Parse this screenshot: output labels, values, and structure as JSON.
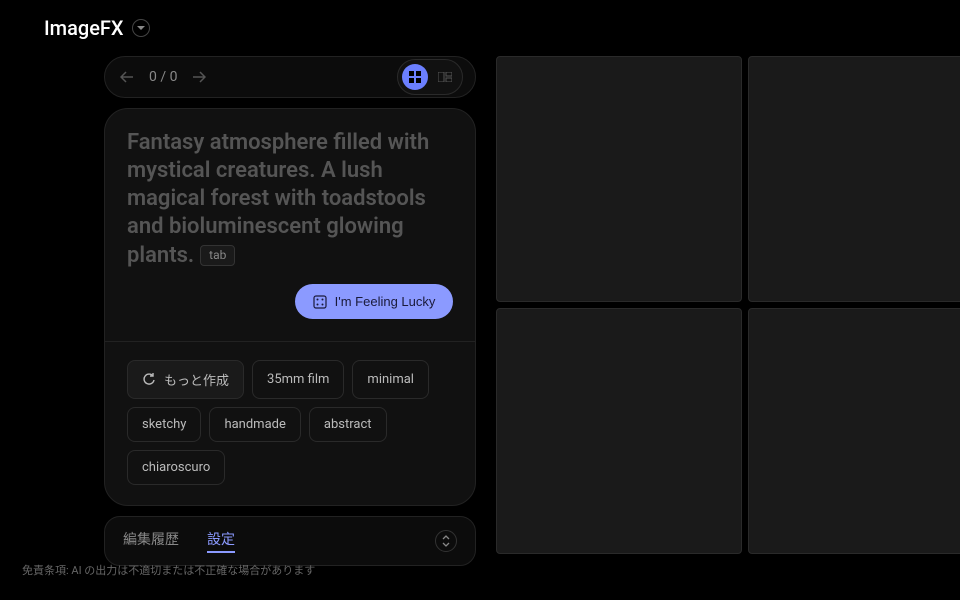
{
  "header": {
    "logo": "ImageFX"
  },
  "nav": {
    "count": "0 / 0"
  },
  "prompt": {
    "text": "Fantasy atmosphere filled with mystical creatures. A lush magical forest with toadstools and bioluminescent glowing plants.",
    "tab_label": "tab"
  },
  "lucky": {
    "label": "I'm Feeling Lucky"
  },
  "chips": {
    "more": "もっと作成",
    "items": [
      "35mm film",
      "minimal",
      "sketchy",
      "handmade",
      "abstract",
      "chiaroscuro"
    ]
  },
  "bottom": {
    "tab_history": "編集履歴",
    "tab_settings": "設定"
  },
  "disclaimer": "免責条項: AI の出力は不適切または不正確な場合があります"
}
